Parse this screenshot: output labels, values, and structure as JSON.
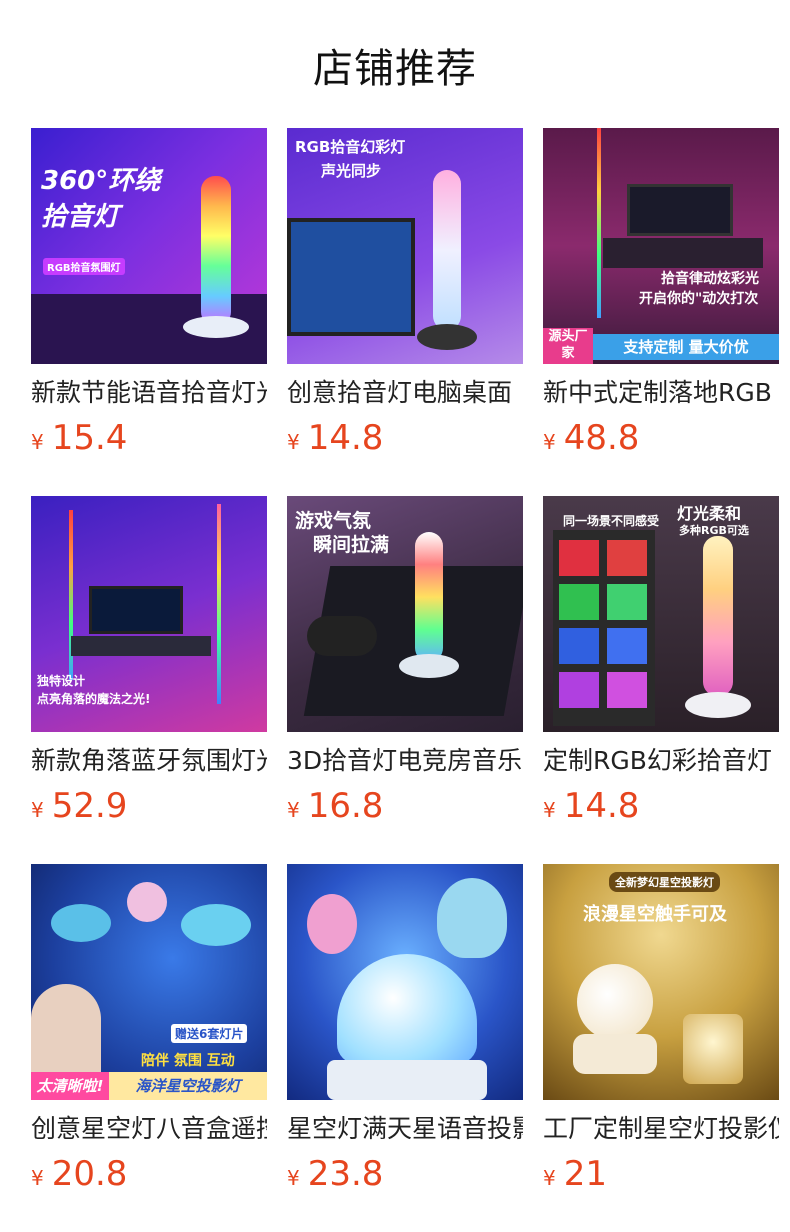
{
  "header": {
    "title": "店铺推荐"
  },
  "products": [
    {
      "name": "新款节能语音拾音灯光",
      "currency": "¥",
      "price": "15.4",
      "image_text": [
        "360°环绕",
        "拾音灯",
        "RGB拾音氛围灯"
      ],
      "image_bg": "#6a2bd1"
    },
    {
      "name": "创意拾音灯电脑桌面",
      "currency": "¥",
      "price": "14.8",
      "image_text": [
        "RGB拾音幻彩灯",
        "声光同步"
      ],
      "image_bg": "#7a3ee0"
    },
    {
      "name": "新中式定制落地RGB",
      "currency": "¥",
      "price": "48.8",
      "image_text": [
        "拾音律动炫彩光",
        "开启你的\"动次打次",
        "源头厂家",
        "支持定制 量大价优"
      ],
      "image_bg": "#8b1e6d"
    },
    {
      "name": "新款角落蓝牙氛围灯光",
      "currency": "¥",
      "price": "52.9",
      "image_text": [
        "独特设计",
        "点亮角落的魔法之光!"
      ],
      "image_bg": "#5a1fa8"
    },
    {
      "name": "3D拾音灯电竞房音乐",
      "currency": "¥",
      "price": "16.8",
      "image_text": [
        "游戏气氛",
        "瞬间拉满"
      ],
      "image_bg": "#4b3a55"
    },
    {
      "name": "定制RGB幻彩拾音灯",
      "currency": "¥",
      "price": "14.8",
      "image_text": [
        "同一场景不同感受",
        "灯光柔和",
        "多种RGB可选"
      ],
      "image_bg": "#3a2d3a"
    },
    {
      "name": "创意星空灯八音盒遥控",
      "currency": "¥",
      "price": "20.8",
      "image_text": [
        "赠送6套灯片",
        "陪伴 氛围 互动",
        "太清晰啦!",
        "海洋星空投影灯"
      ],
      "image_bg": "#1c3f9e"
    },
    {
      "name": "星空灯满天星语音投影",
      "currency": "¥",
      "price": "23.8",
      "image_text": [],
      "image_bg": "#2a55c8"
    },
    {
      "name": "工厂定制星空灯投影仪",
      "currency": "¥",
      "price": "21",
      "image_text": [
        "全新梦幻星空投影灯",
        "浪漫星空触手可及"
      ],
      "image_bg": "#8a6a1e"
    }
  ]
}
